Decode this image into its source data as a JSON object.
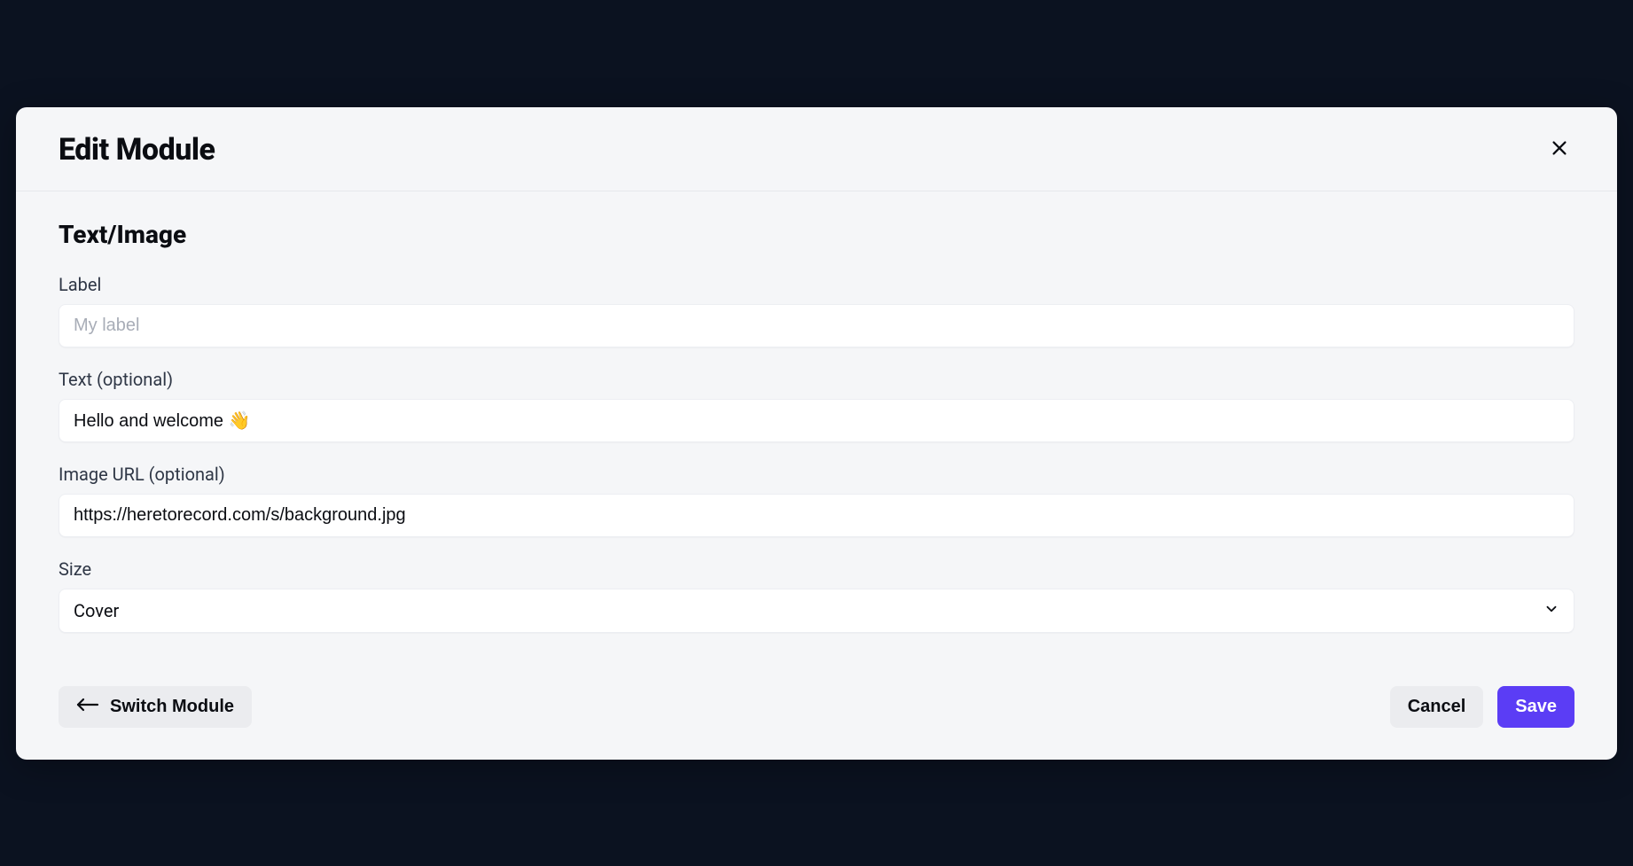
{
  "header": {
    "title": "Edit Module"
  },
  "section": {
    "title": "Text/Image"
  },
  "fields": {
    "label": {
      "label": "Label",
      "placeholder": "My label",
      "value": ""
    },
    "text": {
      "label": "Text (optional)",
      "value": "Hello and welcome 👋"
    },
    "imageUrl": {
      "label": "Image URL (optional)",
      "value": "https://heretorecord.com/s/background.jpg"
    },
    "size": {
      "label": "Size",
      "value": "Cover"
    }
  },
  "footer": {
    "switchModule": "Switch Module",
    "cancel": "Cancel",
    "save": "Save"
  }
}
